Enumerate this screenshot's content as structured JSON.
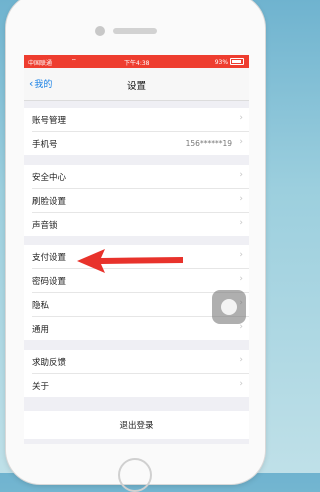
{
  "status_bar": {
    "carrier": "中国联通",
    "wifi_icon": "wifi-icon",
    "time": "下午4:38",
    "battery_percent": "93%"
  },
  "nav": {
    "back_label": "我的",
    "title": "设置"
  },
  "groups": [
    {
      "items": [
        {
          "label": "账号管理",
          "value": ""
        },
        {
          "label": "手机号",
          "value": "156******19"
        }
      ]
    },
    {
      "items": [
        {
          "label": "安全中心",
          "value": ""
        },
        {
          "label": "刷脸设置",
          "value": ""
        },
        {
          "label": "声音锁",
          "value": ""
        }
      ]
    },
    {
      "items": [
        {
          "label": "支付设置",
          "value": ""
        },
        {
          "label": "密码设置",
          "value": ""
        },
        {
          "label": "隐私",
          "value": ""
        },
        {
          "label": "通用",
          "value": ""
        }
      ]
    },
    {
      "items": [
        {
          "label": "求助反馈",
          "value": ""
        },
        {
          "label": "关于",
          "value": ""
        }
      ]
    }
  ],
  "logout_label": "退出登录",
  "colors": {
    "status_bar": "#ee3d2f",
    "accent": "#1a82e6",
    "annotation_arrow": "#e8322b"
  }
}
